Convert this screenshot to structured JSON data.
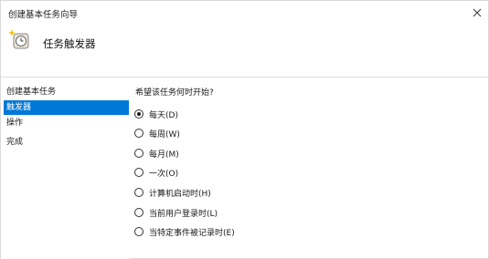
{
  "window": {
    "title": "创建基本任务向导",
    "close_glyph": "✕"
  },
  "header": {
    "title": "任务触发器",
    "icon": "task-scheduler-clock-icon"
  },
  "sidebar": {
    "items": [
      {
        "label": "创建基本任务",
        "active": false
      },
      {
        "label": "触发器",
        "active": true
      },
      {
        "label": "操作",
        "active": false
      },
      {
        "label": "完成",
        "active": false
      }
    ]
  },
  "main": {
    "question": "希望该任务何时开始?",
    "selected_index": 0,
    "options": [
      {
        "label": "每天(D)"
      },
      {
        "label": "每周(W)"
      },
      {
        "label": "每月(M)"
      },
      {
        "label": "一次(O)"
      },
      {
        "label": "计算机启动时(H)"
      },
      {
        "label": "当前用户登录时(L)"
      },
      {
        "label": "当特定事件被记录时(E)"
      }
    ]
  },
  "colors": {
    "selection_bg": "#0078d7",
    "selection_text": "#ffffff"
  }
}
